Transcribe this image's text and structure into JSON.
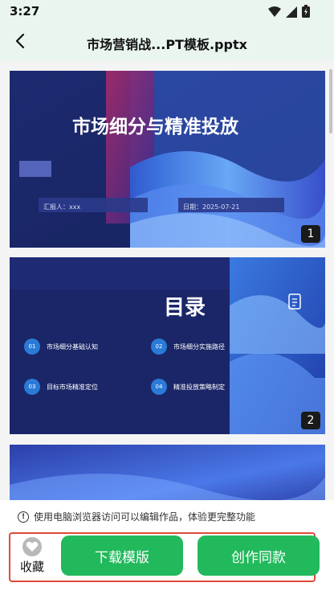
{
  "status_bar": {
    "time": "3:27"
  },
  "header": {
    "title": "市场营销战...PT模板.pptx"
  },
  "slides": [
    {
      "title": "市场细分与精准投放",
      "reporter": "汇报人：xxx",
      "date": "日期：2025-07-21",
      "page": "1"
    },
    {
      "title": "目录",
      "items": [
        {
          "num": "01",
          "text": "市场细分基础认知"
        },
        {
          "num": "02",
          "text": "市场细分实施路径"
        },
        {
          "num": "03",
          "text": "目标市场精准定位"
        },
        {
          "num": "04",
          "text": "精准投放策略制定"
        }
      ],
      "page": "2"
    }
  ],
  "notice": "使用电脑浏览器访问可以编辑作品，体验更完整功能",
  "actions": {
    "favorite_label": "收藏",
    "download_label": "下载模版",
    "create_label": "创作同款"
  },
  "colors": {
    "accent": "#22b95c",
    "highlight_frame": "#e04a3a"
  }
}
